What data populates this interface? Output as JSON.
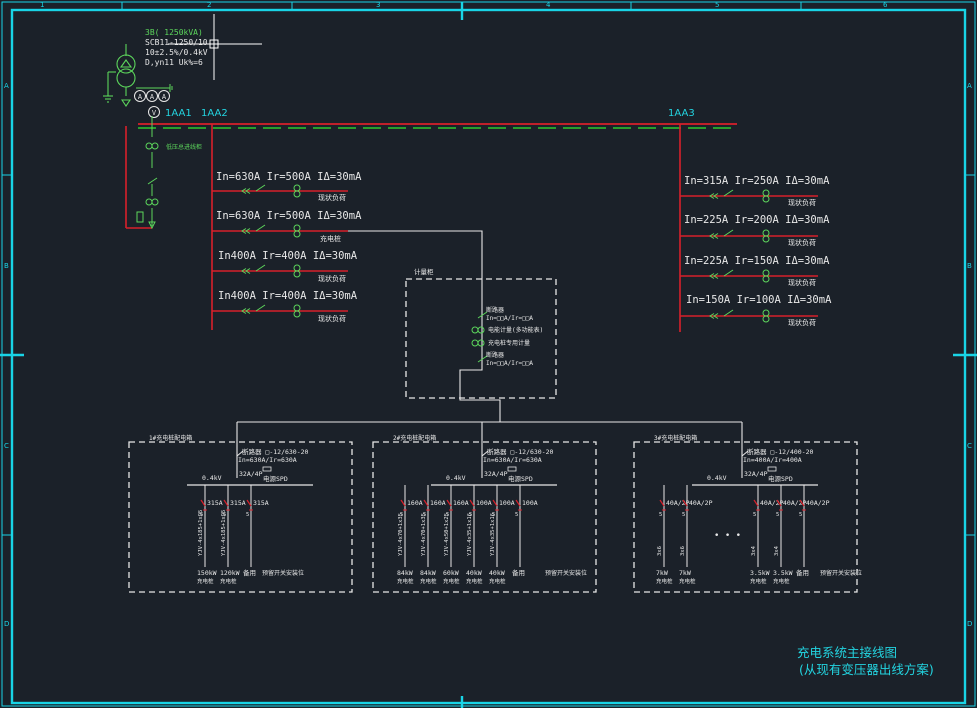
{
  "frame": {
    "col_numbers": [
      "1",
      "2",
      "3",
      "4",
      "5",
      "6"
    ],
    "row_letters": [
      "A",
      "B",
      "C",
      "D"
    ]
  },
  "transformer": {
    "rating": "3B( 1250kVA)",
    "model": "SCB11-1250/10",
    "ratio": "10±2.5%/0.4kV",
    "vector": "D,yn11  Uk%=6",
    "meter_a": "A",
    "meter_v": "V"
  },
  "panels": {
    "aa1": "1AA1",
    "aa2": "1AA2",
    "aa3": "1AA3"
  },
  "incoming_label": "低压总进线柜",
  "feeders_left": [
    {
      "rating": "In=630A Ir=500A IΔ=30mA",
      "load": "现状负荷"
    },
    {
      "rating": "In=630A Ir=500A IΔ=30mA",
      "load": "充电桩"
    },
    {
      "rating": "In400A Ir=400A IΔ=30mA",
      "load": "现状负荷"
    },
    {
      "rating": "In400A Ir=400A IΔ=30mA",
      "load": "现状负荷"
    }
  ],
  "feeders_right": [
    {
      "rating": "In=315A Ir=250A IΔ=30mA",
      "load": "现状负荷"
    },
    {
      "rating": "In=225A Ir=200A IΔ=30mA",
      "load": "现状负荷"
    },
    {
      "rating": "In=225A Ir=150A IΔ=30mA",
      "load": "现状负荷"
    },
    {
      "rating": "In=150A Ir=100A IΔ=30mA",
      "load": "现状负荷"
    }
  ],
  "splitter": {
    "title": "计量柜",
    "breaker1": "断路器",
    "setting1": "In=□□A/Ir=□□A",
    "meter": "电能计量(多功能表)",
    "ct": "充电桩专用计量",
    "breaker2": "断路器",
    "setting2": "In=□□A/Ir=□□A"
  },
  "boxes": [
    {
      "title": "1#充电桩配电箱",
      "breaker": "断路器 □-12/630-20",
      "setting": "In=630A/Ir=630A",
      "main": "32A/4P",
      "spd": "电源SPD",
      "voltage": "0.4kV",
      "outgoing": [
        {
          "rating": "315A",
          "cable": "YJV-4x185+1x95",
          "power": "150kW",
          "desc": "充电桩"
        },
        {
          "rating": "315A",
          "cable": "YJV-4x185+1x95",
          "power": "120kW",
          "desc": "充电桩"
        },
        {
          "rating": "315A",
          "cable": "",
          "power": "备用",
          "desc": ""
        }
      ],
      "reserve": "预留开关安装位"
    },
    {
      "title": "2#充电桩配电箱",
      "breaker": "断路器 □-12/630-20",
      "setting": "In=630A/Ir=630A",
      "main": "32A/4P",
      "spd": "电源SPD",
      "voltage": "0.4kV",
      "outgoing": [
        {
          "rating": "160A",
          "cable": "YJV-4x70+1x35",
          "power": "84kW",
          "desc": "充电桩"
        },
        {
          "rating": "160A",
          "cable": "YJV-4x70+1x35",
          "power": "84kW",
          "desc": "充电桩"
        },
        {
          "rating": "160A",
          "cable": "YJV-4x50+1x25",
          "power": "60kW",
          "desc": "充电桩"
        },
        {
          "rating": "100A",
          "cable": "YJV-4x35+1x16",
          "power": "40kW",
          "desc": "充电桩"
        },
        {
          "rating": "100A",
          "cable": "YJV-4x35+1x16",
          "power": "40kW",
          "desc": "充电桩"
        },
        {
          "rating": "100A",
          "cable": "",
          "power": "备用",
          "desc": ""
        }
      ],
      "reserve": "预留开关安装位"
    },
    {
      "title": "3#充电桩配电箱",
      "breaker": "断路器 □-12/400-20",
      "setting": "In=400A/Ir=400A",
      "main": "32A/4P",
      "spd": "电源SPD",
      "voltage": "0.4kV",
      "outgoing": [
        {
          "rating": "40A/2P",
          "cable": "3x6",
          "power": "7kW",
          "desc": "充电桩"
        },
        {
          "rating": "40A/2P",
          "cable": "3x6",
          "power": "7kW",
          "desc": "充电桩"
        },
        {
          "rating": "40A/2P",
          "cable": "3x4",
          "power": "3.5kW",
          "desc": "充电桩"
        },
        {
          "rating": "40A/2P",
          "cable": "3x4",
          "power": "3.5kW",
          "desc": "充电桩"
        },
        {
          "rating": "40A/2P",
          "cable": "",
          "power": "备用",
          "desc": ""
        }
      ],
      "reserve": "预留开关安装位",
      "ellipsis": "• • •"
    }
  ],
  "title_block": {
    "line1": "充电系统主接线图",
    "line2": "(从现有变压器出线方案)"
  },
  "colors": {
    "background": "#1b2129",
    "frame": "#19d4e6",
    "bus_red": "#d8202a",
    "bus_green": "#2ec82e",
    "symbol_green": "#5cd65c",
    "wire_white": "#e8e8e8"
  }
}
